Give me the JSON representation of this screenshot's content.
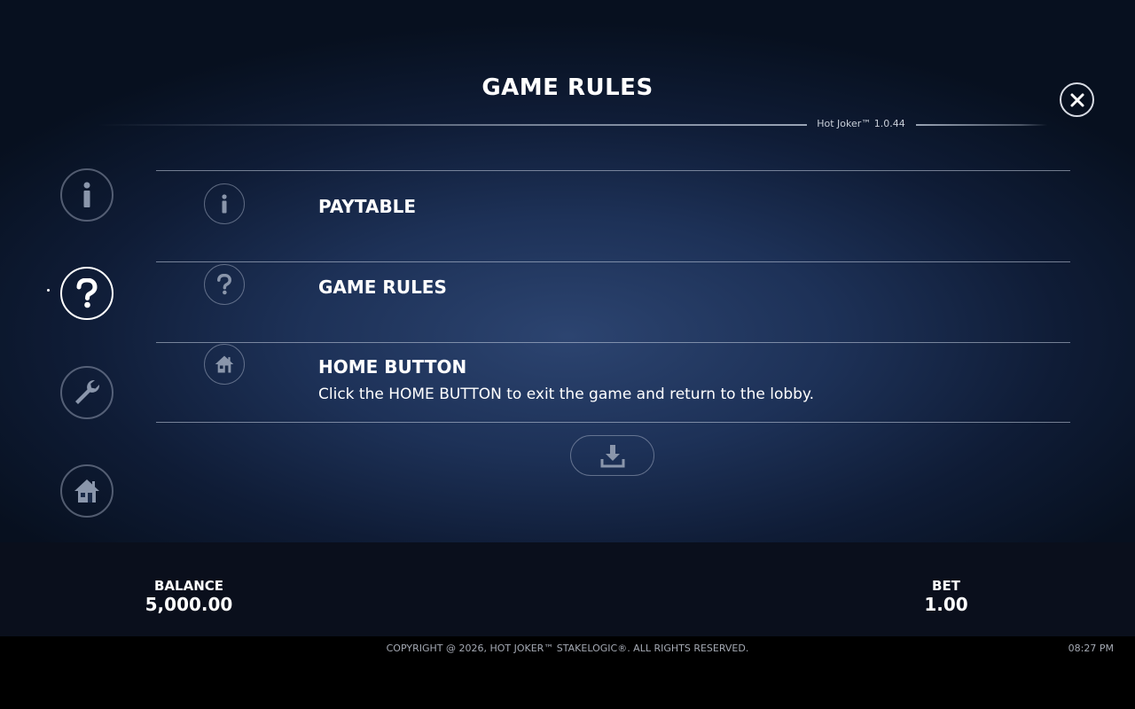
{
  "header": {
    "title": "GAME RULES",
    "version": "Hot Joker™ 1.0.44",
    "close_label": "X"
  },
  "sidebar": {
    "items": [
      {
        "icon": "info-icon",
        "active": false
      },
      {
        "icon": "question-icon",
        "active": true
      },
      {
        "icon": "wrench-icon",
        "active": false
      },
      {
        "icon": "home-icon",
        "active": false
      }
    ]
  },
  "sections": [
    {
      "icon": "info-icon",
      "heading": "PAYTABLE",
      "description": ""
    },
    {
      "icon": "question-icon",
      "heading": "GAME RULES",
      "description": ""
    },
    {
      "icon": "home-icon",
      "heading": "HOME BUTTON",
      "description": "Click the HOME BUTTON to exit the game and return to the lobby."
    }
  ],
  "download": {
    "icon": "download-icon"
  },
  "status": {
    "balance_label": "BALANCE",
    "balance_value": "5,000.00",
    "bet_label": "BET",
    "bet_value": "1.00"
  },
  "footer": {
    "copyright": "COPYRIGHT @ 2026, HOT JOKER™ STAKELOGIC®. ALL RIGHTS RESERVED.",
    "time": "08:27 PM"
  },
  "colors": {
    "panel_center": "#2c4470",
    "panel_edge": "#07101f",
    "bar": "#0a0f1c",
    "icon_dim": "#8a96ab",
    "text": "#ffffff"
  }
}
